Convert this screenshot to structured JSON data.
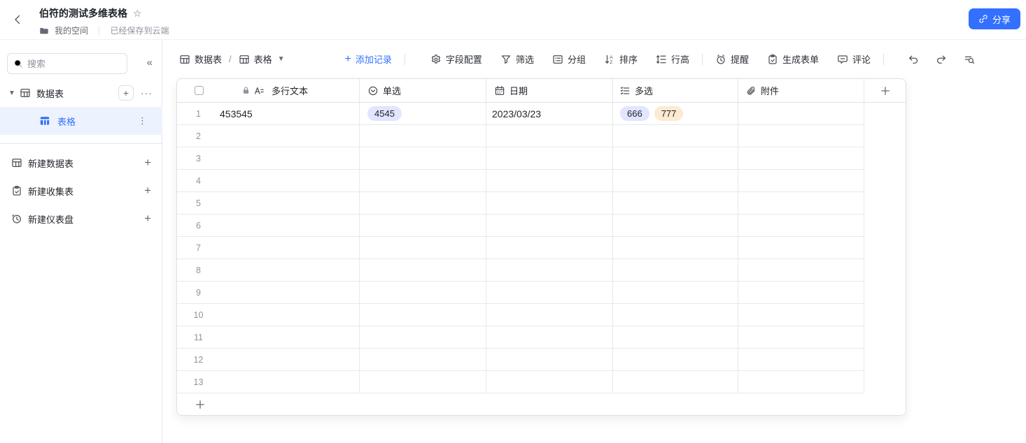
{
  "topbar": {
    "title": "伯符的测试多维表格",
    "space_label": "我的空间",
    "save_status": "已经保存到云端",
    "share_button": {
      "label": "分享"
    }
  },
  "sidebar": {
    "search": {
      "placeholder": "搜索"
    },
    "tree_section": {
      "label": "数据表"
    },
    "tree_items": [
      {
        "label": "表格",
        "selected": true
      }
    ],
    "create_actions": [
      {
        "label": "新建数据表"
      },
      {
        "label": "新建收集表"
      },
      {
        "label": "新建仪表盘"
      }
    ]
  },
  "toolbar": {
    "breadcrumb": {
      "root": "数据表",
      "current": "表格",
      "separator": "/"
    },
    "add_record_label": "添加记录",
    "actions": [
      "字段配置",
      "筛选",
      "分组",
      "排序",
      "行高",
      "提醒",
      "生成表单",
      "评论"
    ]
  },
  "table": {
    "columns": [
      {
        "label": "多行文本",
        "type": "multiline-text",
        "locked": true
      },
      {
        "label": "单选",
        "type": "single-select"
      },
      {
        "label": "日期",
        "type": "date"
      },
      {
        "label": "多选",
        "type": "multi-select"
      },
      {
        "label": "附件",
        "type": "attachment"
      }
    ],
    "rows": [
      {
        "num": "1",
        "text": "453545",
        "single": {
          "label": "4545",
          "color": "blue"
        },
        "date": "2023/03/23",
        "multi": [
          {
            "label": "666",
            "color": "blue"
          },
          {
            "label": "777",
            "color": "orange"
          }
        ]
      },
      {
        "num": "2"
      },
      {
        "num": "3"
      },
      {
        "num": "4"
      },
      {
        "num": "5"
      },
      {
        "num": "6"
      },
      {
        "num": "7"
      },
      {
        "num": "8"
      },
      {
        "num": "9"
      },
      {
        "num": "10"
      },
      {
        "num": "11"
      },
      {
        "num": "12"
      },
      {
        "num": "13"
      }
    ]
  },
  "colors": {
    "accent": "#3370ff",
    "selected_bg": "#edf3fe",
    "badge_blue": "#e1e5ff",
    "badge_orange": "#fdead2",
    "panel_border": "#dee0e3",
    "grid_line": "#e7e9ec",
    "text_primary": "#1f2329",
    "text_secondary": "#646a73",
    "text_muted": "#8f959e"
  }
}
